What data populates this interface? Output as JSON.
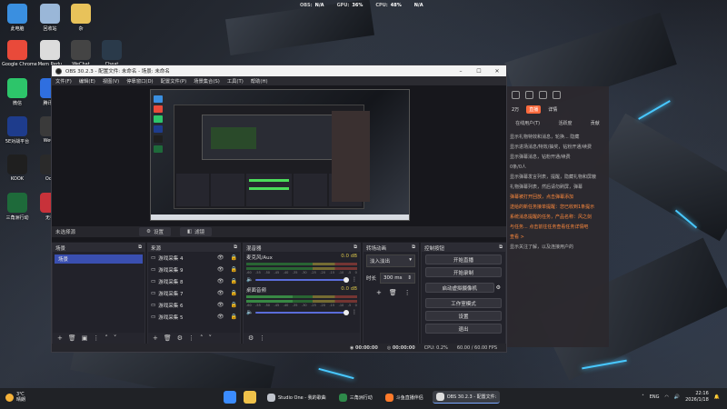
{
  "perf": {
    "obs_label": "OBS:",
    "obs_value": "N/A",
    "gpu_label": "GPU:",
    "gpu_value": "36%",
    "cpu_label": "CPU:",
    "cpu_value": "48%",
    "extra_label": "",
    "extra_value": "N/A"
  },
  "desktop_icons": [
    {
      "label": "此电脑",
      "color": "#3a8fe0"
    },
    {
      "label": "回收站",
      "color": "#9ab7d8"
    },
    {
      "label": "杂",
      "color": "#e8c25a"
    },
    {
      "label": "Google Chrome",
      "color": "#e94a3a"
    },
    {
      "label": "Mem Redu",
      "color": "#dcdcdc"
    },
    {
      "label": "WeChat",
      "color": "#444"
    },
    {
      "label": "Cheat",
      "color": "#2a3a4a"
    },
    {
      "label": "微信",
      "color": "#2dc56a"
    },
    {
      "label": "腾讯会",
      "color": "#2f6fe0"
    },
    {
      "label": "5E对战平台",
      "color": "#1e3c8c"
    },
    {
      "label": "WeGa",
      "color": "#3a3a3a"
    },
    {
      "label": "KOOK",
      "color": "#1f1f1f"
    },
    {
      "label": "Oop",
      "color": "#2a2a2a"
    },
    {
      "label": "三角洲行动",
      "color": "#1e6a3a"
    },
    {
      "label": "无畏",
      "color": "#c8323a"
    }
  ],
  "chat": {
    "stat": "2万",
    "badge": "直播",
    "mode": "详情",
    "tabs": [
      "在线用户(T)",
      "活跃度",
      "贡献"
    ],
    "lines": [
      "显示礼物特效和消息，轮换... 隐藏",
      "显示进场消息/特效/抽奖，钻粉开通/续费",
      "显示弹幕消息，钻粉开通/续费",
      "0条/0人",
      "显示弹幕发言列表，提醒，隐藏礼物和屏蔽",
      "礼物弹幕列表，然后请勿刷屏，弹幕",
      "弹幕被打开回放，点击弹幕添加",
      "送给的新任务接单提醒：您已收到1条提示",
      "系统消息提醒的任务，产品名称：风之剑",
      "与任务... 点击前往任务查看任务详情吧",
      "查看 >",
      "显示关注了解，以及连接用户的"
    ]
  },
  "obs": {
    "title": "OBS 30.2.3 - 配置文件: 未命名 - 场景: 未命名",
    "menu": [
      "文件(F)",
      "编辑(E)",
      "视图(V)",
      "停靠窗口(D)",
      "配置文件(P)",
      "场景集合(S)",
      "工具(T)",
      "帮助(H)"
    ],
    "scene_bar": {
      "label": "未选择源",
      "settings": "设置",
      "filters": "滤镜"
    },
    "docks": {
      "scenes": {
        "title": "场景",
        "items": [
          "场景"
        ]
      },
      "sources": {
        "title": "来源",
        "items": [
          "游戏采集 4",
          "游戏采集 9",
          "游戏采集 8",
          "游戏采集 7",
          "游戏采集 6",
          "游戏采集 5"
        ]
      },
      "mixer": {
        "title": "混音器",
        "tracks": [
          {
            "name": "麦克风/Aux",
            "db": "0.0 dB",
            "level": 0.0,
            "ticks": [
              "-60",
              "-55",
              "-50",
              "-45",
              "-40",
              "-35",
              "-30",
              "-25",
              "-20",
              "-15",
              "-10",
              "-5",
              "0"
            ]
          },
          {
            "name": "桌面音频",
            "db": "0.0 dB",
            "level": 0.42,
            "ticks": [
              "-60",
              "-55",
              "-50",
              "-45",
              "-40",
              "-35",
              "-30",
              "-25",
              "-20",
              "-15",
              "-10",
              "-5",
              "0"
            ]
          }
        ]
      },
      "transitions": {
        "title": "转场动画",
        "selected": "淡入淡出",
        "duration_label": "时长",
        "duration_value": "300 ms"
      },
      "controls": {
        "title": "控制按钮",
        "buttons": [
          "开始直播",
          "开始录制",
          "启动虚拟摄像机",
          "工作室模式",
          "设置",
          "退出"
        ]
      }
    },
    "status": {
      "rec_time": "00:00:00",
      "stream_time": "00:00:00",
      "cpu": "CPU: 0.2%",
      "fps": "60.00 / 60.00 FPS"
    }
  },
  "taskbar": {
    "weather_temp": "3℃",
    "weather_desc": "晴朗",
    "apps": [
      {
        "label": "Studio One - 我的歌曲",
        "color": "#c0c4cc",
        "active": false
      },
      {
        "label": "三角洲行动",
        "color": "#2e8a4a",
        "active": false
      },
      {
        "label": "斗鱼直播伴侣",
        "color": "#ff7a2a",
        "active": false
      },
      {
        "label": "OBS 30.2.3 - 配置文件:",
        "color": "#ddd",
        "active": true
      }
    ],
    "lang": "ENG",
    "time": "22:16",
    "date": "2026/1/18"
  },
  "colors": {
    "accent": "#3a4fb0",
    "meter_green": "#4bdc5a",
    "db_yellow": "#d6c24a"
  }
}
